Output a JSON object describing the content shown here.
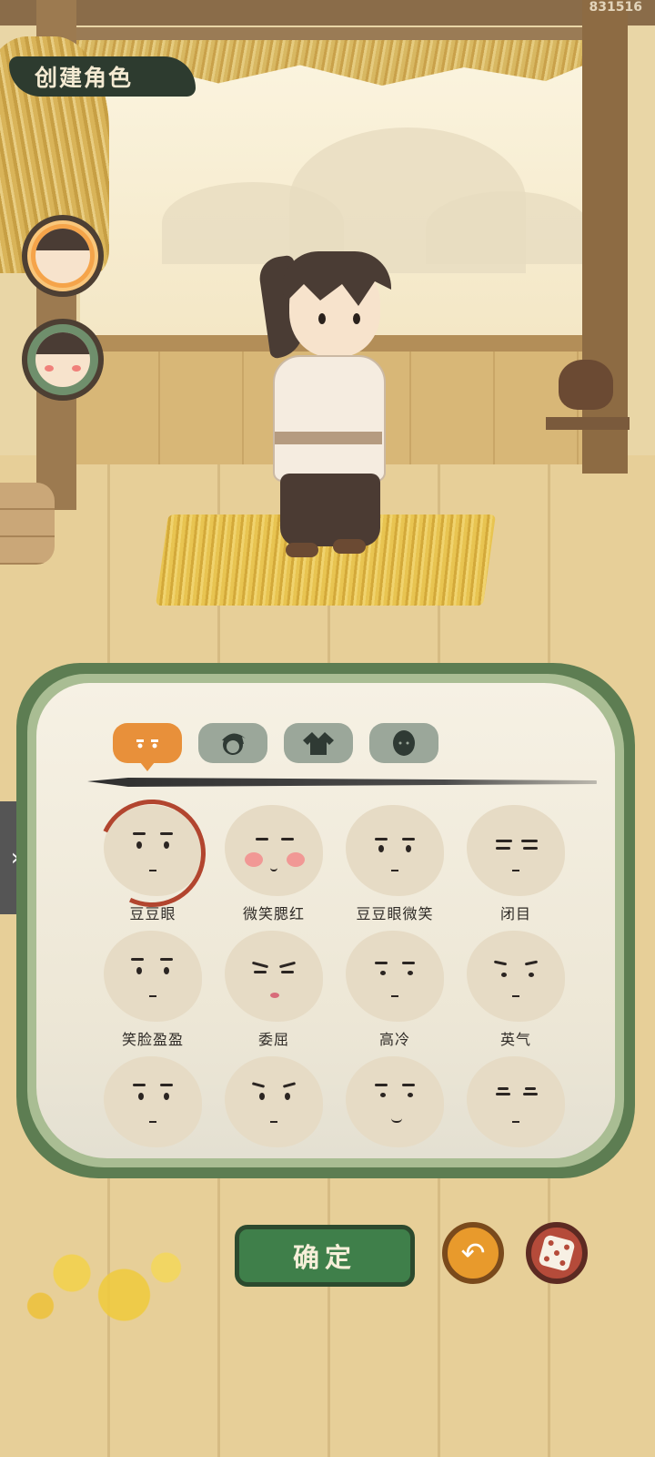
{
  "header": {
    "title": "创建角色",
    "build_id": "831516"
  },
  "avatars": [
    {
      "name": "male-avatar",
      "selected": true
    },
    {
      "name": "female-avatar",
      "selected": false
    }
  ],
  "tabs": [
    {
      "id": "face",
      "icon": "face-eyes-icon",
      "active": true
    },
    {
      "id": "hair",
      "icon": "hair-icon",
      "active": false
    },
    {
      "id": "clothes",
      "icon": "clothes-icon",
      "active": false
    },
    {
      "id": "skin",
      "icon": "head-silhouette-icon",
      "active": false
    }
  ],
  "expressions": [
    {
      "label": "豆豆眼",
      "selected": true
    },
    {
      "label": "微笑腮红",
      "selected": false
    },
    {
      "label": "豆豆眼微笑",
      "selected": false
    },
    {
      "label": "闭目",
      "selected": false
    },
    {
      "label": "笑脸盈盈",
      "selected": false
    },
    {
      "label": "委屈",
      "selected": false
    },
    {
      "label": "高冷",
      "selected": false
    },
    {
      "label": "英气",
      "selected": false
    },
    {
      "label": "",
      "selected": false
    },
    {
      "label": "",
      "selected": false
    },
    {
      "label": "",
      "selected": false
    },
    {
      "label": "",
      "selected": false
    }
  ],
  "buttons": {
    "confirm_label": "确定",
    "undo_icon": "↶",
    "random_icon": "dice-icon",
    "side_expand_icon": "›"
  },
  "colors": {
    "panel_border": "#5d7d52",
    "active_tab": "#e8903a",
    "confirm_button": "#3f7f4a",
    "undo_button": "#e89a2c",
    "dice_button": "#b54b3a",
    "selection_ring": "#b2452f"
  }
}
